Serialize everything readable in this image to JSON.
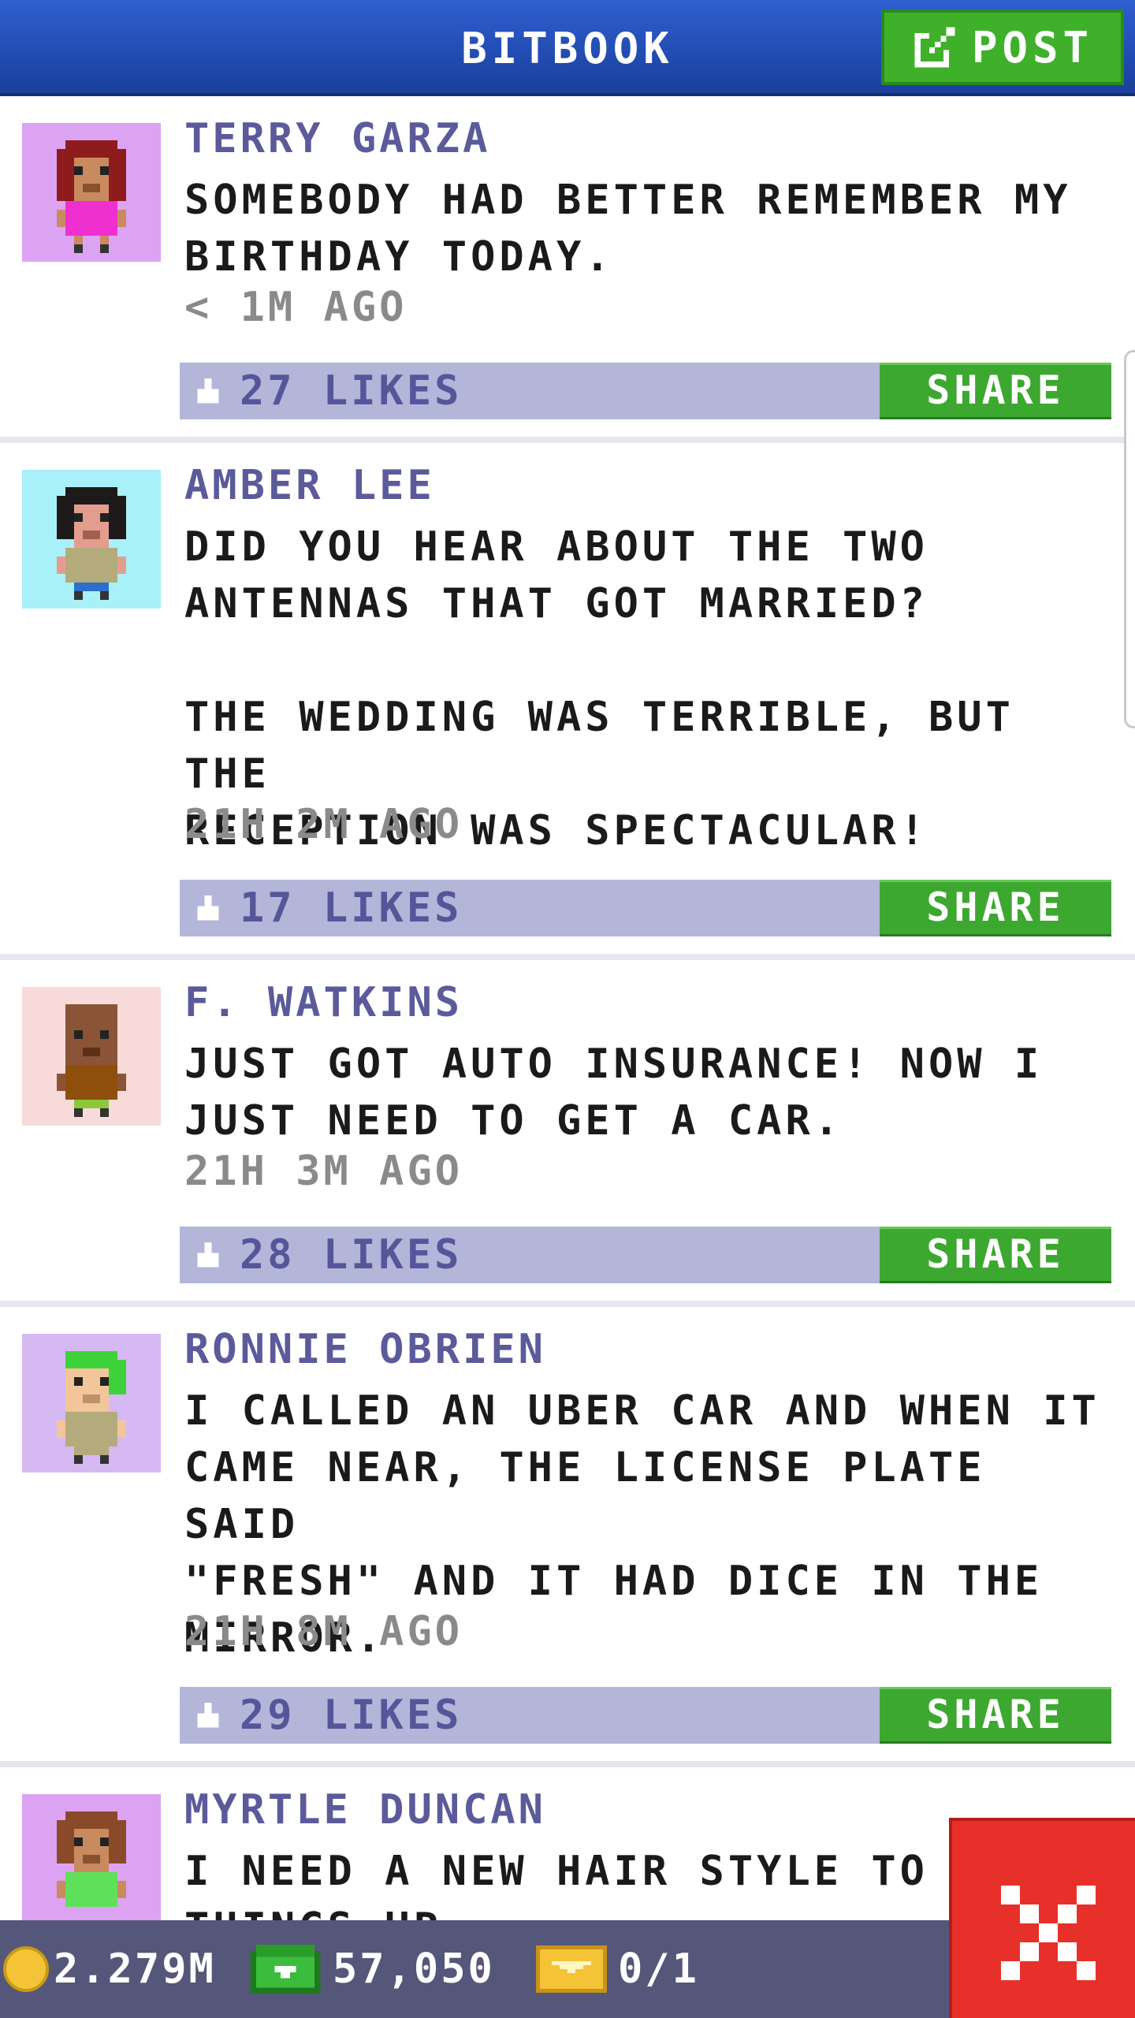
{
  "header": {
    "title": "BITBOOK",
    "post_label": "POST"
  },
  "posts": [
    {
      "author": "TERRY GARZA",
      "message": "SOMEBODY HAD BETTER REMEMBER MY\nBIRTHDAY TODAY.",
      "time": "< 1M AGO",
      "likes": "27 LIKES",
      "share_label": "SHARE",
      "avatar_bg": "#dca3f2"
    },
    {
      "author": "AMBER LEE",
      "message": "DID YOU HEAR ABOUT THE TWO\nANTENNAS THAT GOT MARRIED?\n\nTHE WEDDING WAS TERRIBLE, BUT THE\nRECEPTION WAS SPECTACULAR!",
      "time": "21H 2M AGO",
      "likes": "17 LIKES",
      "share_label": "SHARE",
      "avatar_bg": "#a9f1f8"
    },
    {
      "author": "F. WATKINS",
      "message": "JUST GOT AUTO INSURANCE! NOW I\nJUST NEED TO GET A CAR.",
      "time": "21H 3M AGO",
      "likes": "28 LIKES",
      "share_label": "SHARE",
      "avatar_bg": "#f8dada"
    },
    {
      "author": "RONNIE OBRIEN",
      "message": "I CALLED AN UBER CAR AND WHEN IT\nCAME NEAR, THE LICENSE PLATE SAID\n\"FRESH\" AND IT HAD DICE IN THE\nMIRROR.",
      "time": "21H 8M AGO",
      "likes": "29 LIKES",
      "share_label": "SHARE",
      "avatar_bg": "#d6b8f2"
    },
    {
      "author": "MYRTLE DUNCAN",
      "message": "I NEED A NEW HAIR STYLE TO MIX\nTHINGS UP.",
      "avatar_bg": "#dca3f2"
    }
  ],
  "bottom_bar": {
    "coins": "2.279M",
    "bux": "57,050",
    "tickets": "0/1"
  },
  "colors": {
    "header": "#1f4aa8",
    "post_button": "#3fb02a",
    "share_button": "#3da82f",
    "likes_bar": "#b3b6d8",
    "close_button": "#e8302a"
  },
  "icons": [
    "edit-icon",
    "like-icon",
    "coin-icon",
    "bux-icon",
    "ticket-icon",
    "close-icon"
  ]
}
